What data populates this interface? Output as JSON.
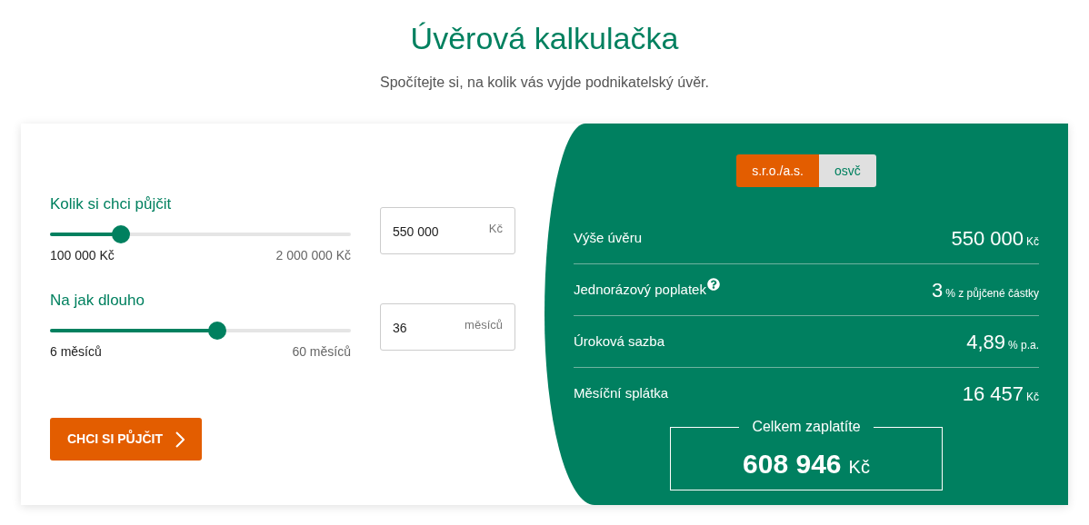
{
  "title": "Úvěrová kalkulačka",
  "subtitle": "Spočítejte si, na kolik vás vyjde podnikatelský úvěr.",
  "sliders": [
    {
      "label": "Kolik si chci půjčit",
      "level": 0.237,
      "min_label": "100 000 Kč",
      "max_label": "2 000 000 Kč",
      "value": "550 000",
      "unit": "Kč"
    },
    {
      "label": "Na jak dlouho",
      "level": 0.556,
      "min_label": "6 měsíců",
      "max_label": "60 měsíců",
      "value": "36",
      "unit": "měsíců"
    }
  ],
  "button": {
    "label": "CHCI SI PŮJČIT"
  },
  "segments": [
    {
      "label": "s.r.o./a.s.",
      "selected": true
    },
    {
      "label": "osvč",
      "selected": false
    }
  ],
  "results": [
    {
      "label": "Výše úvěru",
      "help": false,
      "value": "550 000",
      "unit": "Kč"
    },
    {
      "label": "Jednorázový poplatek",
      "help": true,
      "value": "3",
      "unit": "% z půjčené částky"
    },
    {
      "label": "Úroková sazba",
      "help": false,
      "value": "4,89",
      "unit": "% p.a."
    },
    {
      "label": "Měsíční splátka",
      "help": false,
      "value": "16 457",
      "unit": "Kč"
    }
  ],
  "total": {
    "label": "Celkem zaplatíte",
    "value": "608 946",
    "unit": "Kč"
  }
}
